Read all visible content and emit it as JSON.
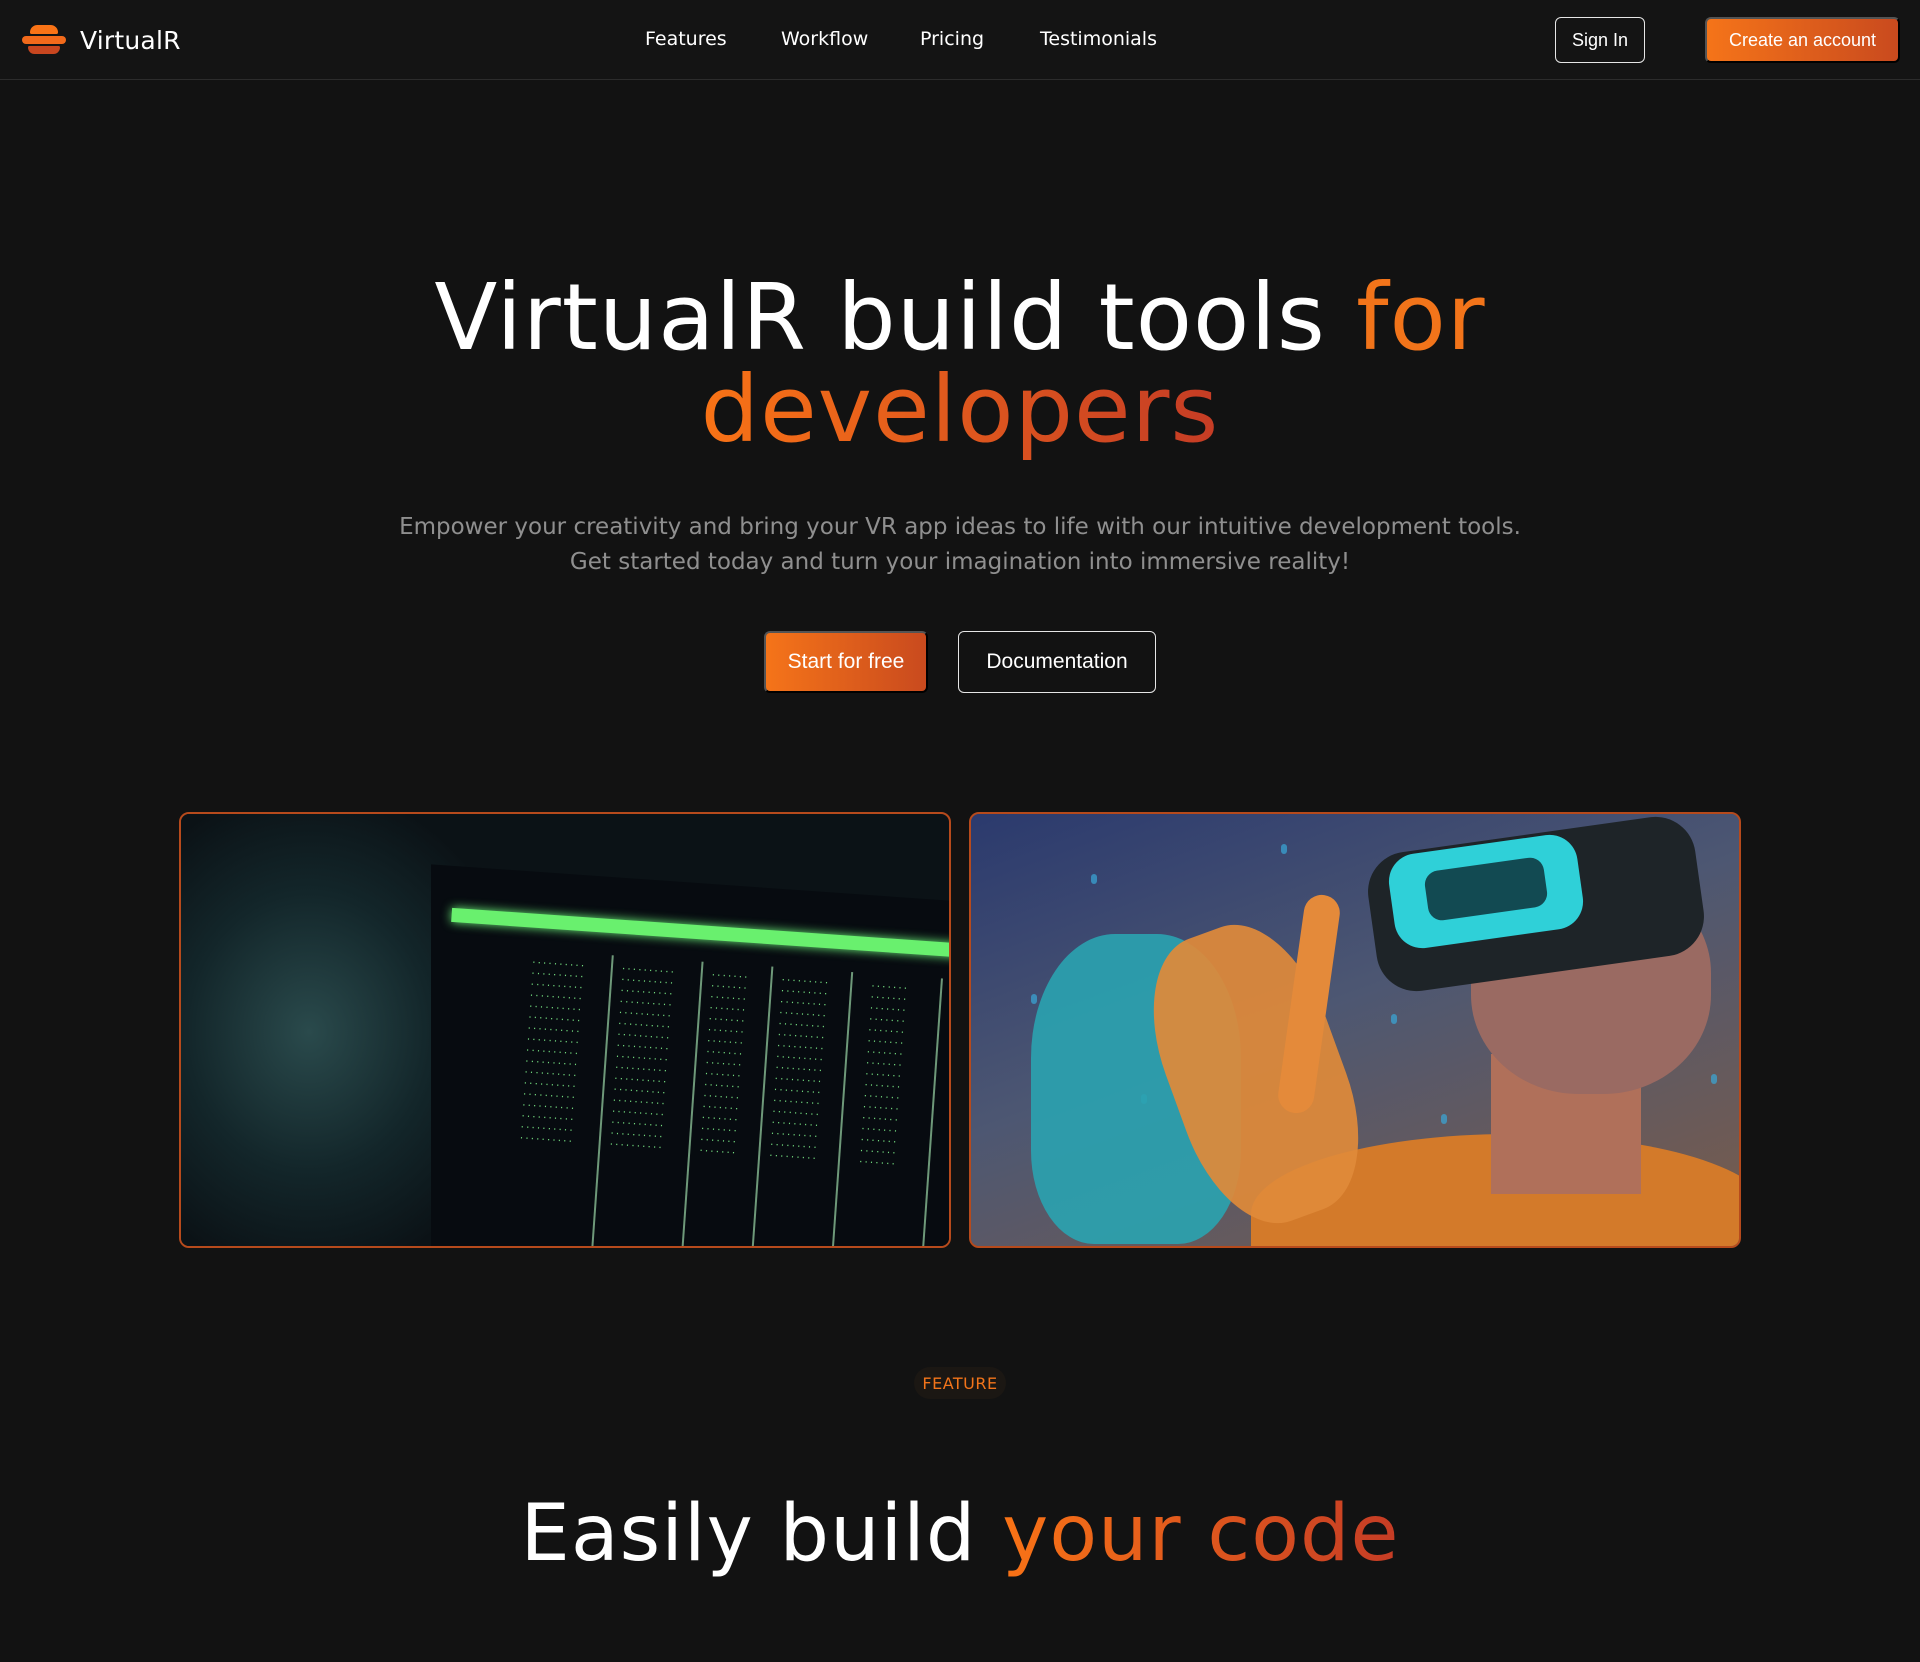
{
  "brand": {
    "name": "VirtualR",
    "icon": "layered-logo-icon"
  },
  "nav": {
    "links": [
      {
        "label": "Features"
      },
      {
        "label": "Workflow"
      },
      {
        "label": "Pricing"
      },
      {
        "label": "Testimonials"
      }
    ],
    "sign_in": "Sign In",
    "create_account": "Create an account"
  },
  "hero": {
    "title_part1": "VirtualR build tools ",
    "title_accent1": "for",
    "title_accent2": "developers",
    "subtitle_line1": "Empower your creativity and bring your VR app ideas to life with our intuitive development tools.",
    "subtitle_line2": "Get started today and turn your imagination into immersive reality!",
    "primary_button": "Start for free",
    "secondary_button": "Documentation"
  },
  "media": {
    "left_image": "terminal-screen-photo",
    "right_image": "vr-headset-person-photo"
  },
  "feature": {
    "badge": "FEATURE",
    "title_part1": "Easily build ",
    "title_accent": "your code"
  },
  "colors": {
    "background": "#121212",
    "accent": "#f97316",
    "accent_dark": "#c53c25",
    "muted_text": "#8f8f8f"
  }
}
